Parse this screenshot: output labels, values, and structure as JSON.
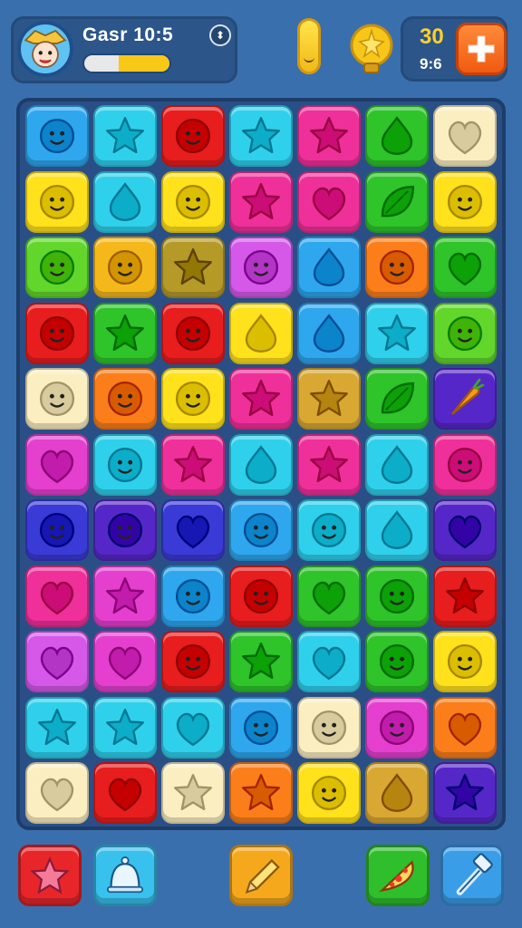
{
  "hud": {
    "player_name": "Gasr 10:5",
    "level_progress": 0.6,
    "coins": "30",
    "moves": "9:6",
    "avatar_icon": "cowboy-avatar-icon",
    "menu_icon": "compass-icon",
    "booster_icon": "yellow-pill-icon",
    "hint_icon": "lightbulb-icon",
    "add_icon": "plus-icon"
  },
  "palette": {
    "blue": "#2ea7ee",
    "cyan": "#2fd0ec",
    "red": "#e81d1d",
    "yellow": "#ffe11c",
    "pink": "#f0309a",
    "green": "#2ec42a",
    "cream": "#fbeec0",
    "lime": "#62d62a",
    "orange": "#fb7e1a",
    "olive": "#b59a28",
    "violet": "#d558e8",
    "magenta": "#e53fcf",
    "navy": "#3a3ad6",
    "indigo": "#5627c8",
    "darkgreen": "#2aa82a",
    "amber": "#f5b81a",
    "gold": "#d8a832"
  },
  "board": {
    "rows": [
      [
        [
          "blue",
          "face"
        ],
        [
          "cyan",
          "star"
        ],
        [
          "red",
          "face"
        ],
        [
          "cyan",
          "star"
        ],
        [
          "pink",
          "star"
        ],
        [
          "green",
          "drop"
        ],
        [
          "cream",
          "heart"
        ]
      ],
      [
        [
          "yellow",
          "face"
        ],
        [
          "cyan",
          "drop"
        ],
        [
          "yellow",
          "face"
        ],
        [
          "pink",
          "star"
        ],
        [
          "pink",
          "heart"
        ],
        [
          "green",
          "leaf"
        ],
        [
          "yellow",
          "face"
        ]
      ],
      [
        [
          "lime",
          "face"
        ],
        [
          "amber",
          "face"
        ],
        [
          "olive",
          "star"
        ],
        [
          "violet",
          "face"
        ],
        [
          "blue",
          "drop"
        ],
        [
          "orange",
          "face"
        ],
        [
          "green",
          "heart"
        ]
      ],
      [
        [
          "red",
          "face"
        ],
        [
          "green",
          "star"
        ],
        [
          "red",
          "face"
        ],
        [
          "yellow",
          "drop"
        ],
        [
          "blue",
          "drop"
        ],
        [
          "cyan",
          "star"
        ],
        [
          "lime",
          "face"
        ]
      ],
      [
        [
          "cream",
          "face"
        ],
        [
          "orange",
          "face"
        ],
        [
          "yellow",
          "face"
        ],
        [
          "pink",
          "star"
        ],
        [
          "gold",
          "star"
        ],
        [
          "green",
          "leaf"
        ],
        [
          "indigo",
          "carrot"
        ]
      ],
      [
        [
          "magenta",
          "heart"
        ],
        [
          "cyan",
          "face"
        ],
        [
          "pink",
          "star"
        ],
        [
          "cyan",
          "drop"
        ],
        [
          "pink",
          "star"
        ],
        [
          "cyan",
          "drop"
        ],
        [
          "pink",
          "face"
        ]
      ],
      [
        [
          "navy",
          "face"
        ],
        [
          "indigo",
          "face"
        ],
        [
          "navy",
          "heart"
        ],
        [
          "blue",
          "face"
        ],
        [
          "cyan",
          "face"
        ],
        [
          "cyan",
          "drop"
        ],
        [
          "indigo",
          "heart"
        ]
      ],
      [
        [
          "pink",
          "heart"
        ],
        [
          "magenta",
          "star"
        ],
        [
          "blue",
          "face"
        ],
        [
          "red",
          "face"
        ],
        [
          "green",
          "heart"
        ],
        [
          "green",
          "face"
        ],
        [
          "red",
          "star"
        ]
      ],
      [
        [
          "violet",
          "heart"
        ],
        [
          "magenta",
          "heart"
        ],
        [
          "red",
          "face"
        ],
        [
          "green",
          "star"
        ],
        [
          "cyan",
          "heart"
        ],
        [
          "green",
          "face"
        ],
        [
          "yellow",
          "face"
        ]
      ],
      [
        [
          "cyan",
          "star"
        ],
        [
          "cyan",
          "star"
        ],
        [
          "cyan",
          "heart"
        ],
        [
          "blue",
          "face"
        ],
        [
          "cream",
          "face"
        ],
        [
          "magenta",
          "face"
        ],
        [
          "orange",
          "heart"
        ]
      ],
      [
        [
          "cream",
          "heart"
        ],
        [
          "red",
          "heart"
        ],
        [
          "cream",
          "star"
        ],
        [
          "orange",
          "star"
        ],
        [
          "yellow",
          "face"
        ],
        [
          "gold",
          "drop"
        ],
        [
          "indigo",
          "star"
        ]
      ]
    ]
  },
  "toolbar": [
    {
      "name": "star-booster-button",
      "color": "#e8262a",
      "icon": "star-icon"
    },
    {
      "name": "bell-booster-button",
      "color": "#39c1ee",
      "icon": "bell-icon"
    },
    {
      "name": "pencil-booster-button",
      "color": "#f6a81c",
      "icon": "pencil-icon"
    },
    {
      "name": "pizza-booster-button",
      "color": "#2fbf2c",
      "icon": "pizza-icon"
    },
    {
      "name": "hammer-booster-button",
      "color": "#3a9de8",
      "icon": "hammer-icon"
    }
  ]
}
